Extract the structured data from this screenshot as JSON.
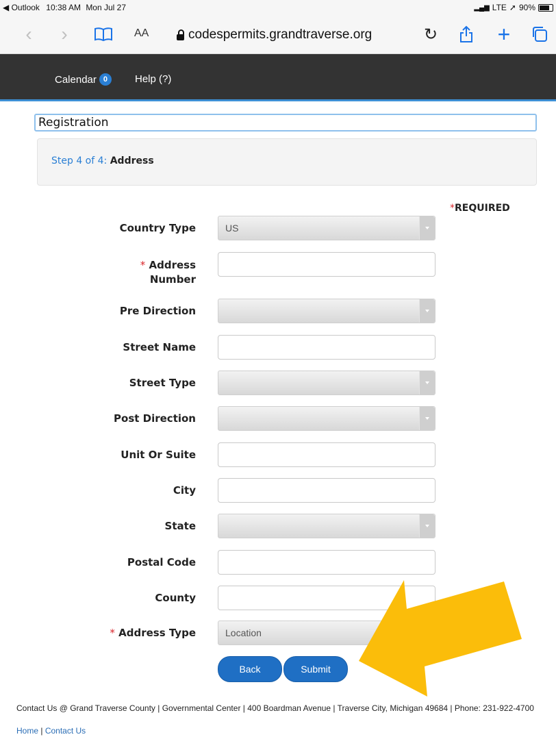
{
  "status_bar": {
    "back_app": "◀ Outlook",
    "time": "10:38 AM",
    "date": "Mon Jul 27",
    "network": "LTE",
    "battery": "90%",
    "battery_level": 0.9
  },
  "browser": {
    "text_size_label": "AA",
    "url": "codespermits.grandtraverse.org"
  },
  "site_nav": {
    "calendar_label": "Calendar",
    "calendar_count": "0",
    "help_label": "Help (?)"
  },
  "page": {
    "heading": "Registration",
    "step_number": "Step 4 of 4:",
    "step_title": "Address",
    "required_star": "*",
    "required_label": "REQUIRED"
  },
  "form": {
    "country_type": {
      "label": "Country Type",
      "value": "US"
    },
    "address_number": {
      "star": "*",
      "label_line1": "Address",
      "label_line2": "Number",
      "value": ""
    },
    "pre_direction": {
      "label": "Pre Direction",
      "value": ""
    },
    "street_name": {
      "label": "Street Name",
      "value": ""
    },
    "street_type": {
      "label": "Street Type",
      "value": ""
    },
    "post_direction": {
      "label": "Post Direction",
      "value": ""
    },
    "unit_or_suite": {
      "label": "Unit Or Suite",
      "value": ""
    },
    "city": {
      "label": "City",
      "value": ""
    },
    "state": {
      "label": "State",
      "value": ""
    },
    "postal_code": {
      "label": "Postal Code",
      "value": ""
    },
    "county": {
      "label": "County",
      "value": ""
    },
    "address_type": {
      "star": "*",
      "label": "Address Type",
      "value": "Location"
    }
  },
  "buttons": {
    "back": "Back",
    "submit": "Submit"
  },
  "footer": {
    "contact_text": "Contact Us @ Grand Traverse County | Governmental Center | 400 Boardman Avenue | Traverse City, Michigan 49684 | Phone: 231-922-4700",
    "home_link": "Home",
    "separator": "|",
    "contact_link": "Contact Us"
  },
  "colors": {
    "nav_bar": "#333333",
    "accent_blue": "#2a7fd4",
    "button_blue": "#1f6fc4",
    "required_red": "#d9262b",
    "annotation_arrow": "#fbbd0a"
  }
}
